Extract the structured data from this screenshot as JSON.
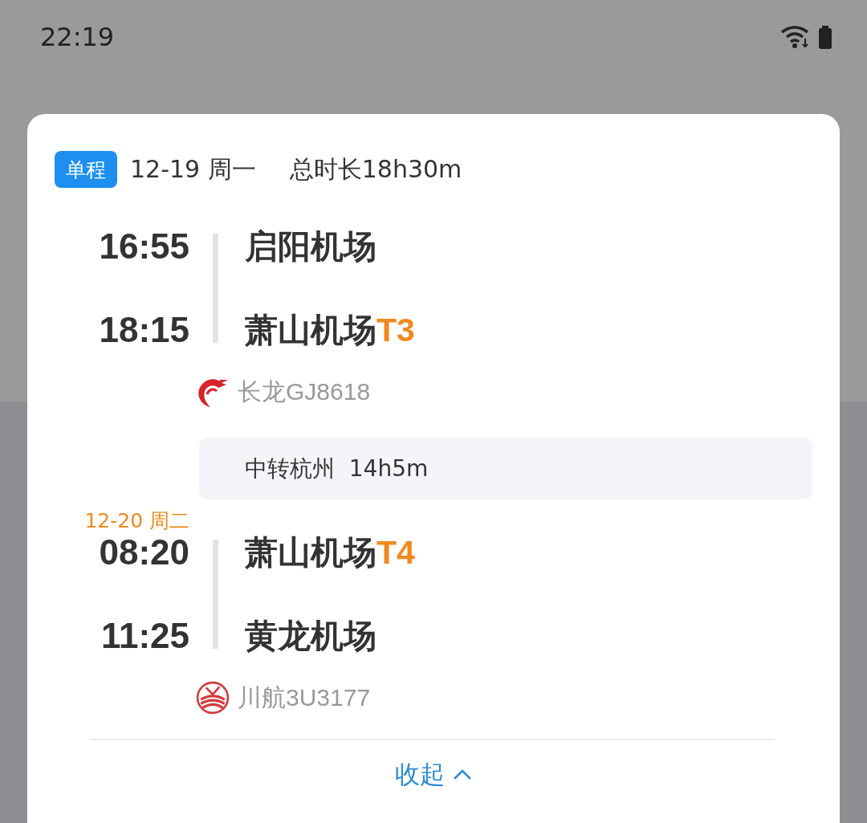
{
  "status_bar": {
    "time": "22:19"
  },
  "trip": {
    "badge": "单程",
    "date": "12-19 周一",
    "total_duration": "总时长18h30m"
  },
  "legs": [
    {
      "kind": "flight",
      "departure": {
        "time": "16:55",
        "airport": "启阳机场"
      },
      "arrival": {
        "time": "18:15",
        "airport": "萧山机场",
        "terminal": "T3"
      },
      "airline": {
        "kind": "dragon",
        "flight": "长龙GJ8618"
      }
    },
    {
      "kind": "transfer",
      "city": "中转杭州",
      "duration": "14h5m"
    },
    {
      "kind": "flight",
      "departure": {
        "date": "12-20 周二",
        "time": "08:20",
        "airport": "萧山机场",
        "terminal": "T4"
      },
      "arrival": {
        "time": "11:25",
        "airport": "黄龙机场"
      },
      "airline": {
        "kind": "bird",
        "flight": "川航3U3177"
      }
    }
  ],
  "collapse": {
    "label": "收起"
  }
}
